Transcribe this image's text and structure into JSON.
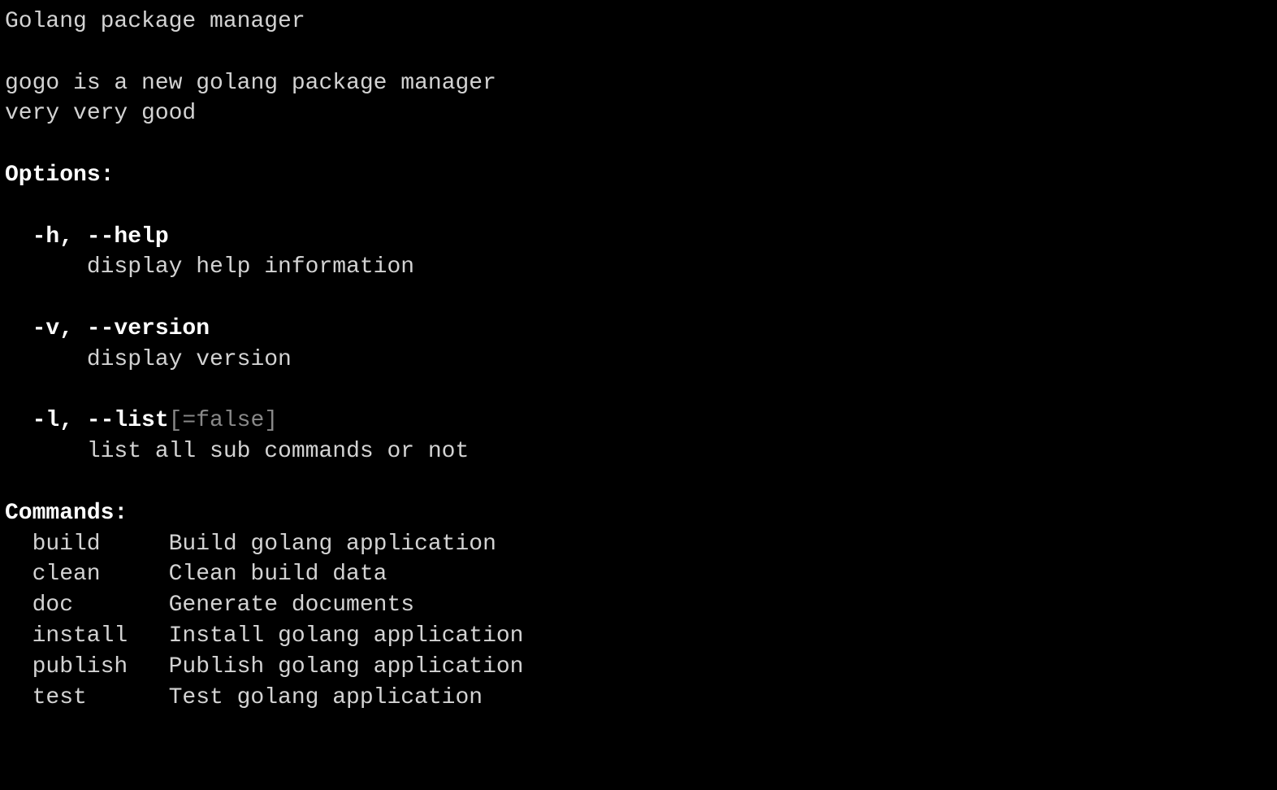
{
  "title": "Golang package manager",
  "description_line1": "gogo is a new golang package manager",
  "description_line2": "very very good",
  "options_header": "Options:",
  "options": [
    {
      "flags": "-h, --help",
      "default": "",
      "desc": "display help information"
    },
    {
      "flags": "-v, --version",
      "default": "",
      "desc": "display version"
    },
    {
      "flags": "-l, --list",
      "default": "[=false]",
      "desc": "list all sub commands or not"
    }
  ],
  "commands_header": "Commands:",
  "commands": [
    {
      "name": "build",
      "desc": "Build golang application"
    },
    {
      "name": "clean",
      "desc": "Clean build data"
    },
    {
      "name": "doc",
      "desc": "Generate documents"
    },
    {
      "name": "install",
      "desc": "Install golang application"
    },
    {
      "name": "publish",
      "desc": "Publish golang application"
    },
    {
      "name": "test",
      "desc": "Test golang application"
    }
  ]
}
